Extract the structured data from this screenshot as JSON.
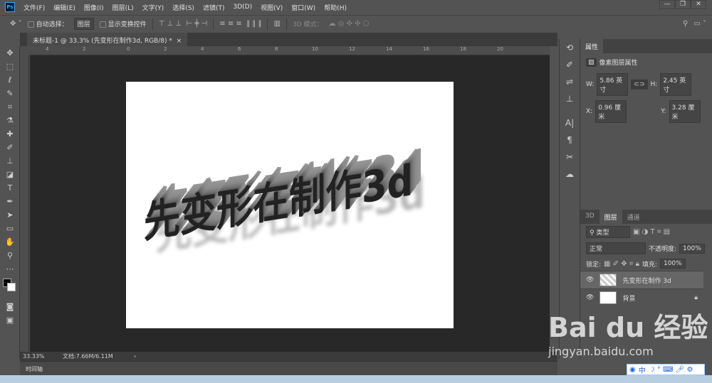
{
  "app": {
    "logo": "Ps"
  },
  "menu": [
    "文件(F)",
    "编辑(E)",
    "图像(I)",
    "图层(L)",
    "文字(Y)",
    "选择(S)",
    "滤镜(T)",
    "3D(D)",
    "视图(V)",
    "窗口(W)",
    "帮助(H)"
  ],
  "window_controls": {
    "minimize": "—",
    "restore": "❐",
    "close": "✕"
  },
  "options": {
    "auto_select_label": "自动选择：",
    "auto_select_value": "图层",
    "show_transform_label": "显示变换控件",
    "mode3d_label": "3D 模式："
  },
  "document_tab": {
    "title": "未标题-1 @ 33.3% (先变形在制作3d, RGB/8) *",
    "close": "×"
  },
  "ruler_ticks": [
    "4",
    "2",
    "0",
    "2",
    "4",
    "6",
    "8",
    "10",
    "12",
    "14",
    "16",
    "18",
    "20"
  ],
  "canvas": {
    "text": "先变形在制作3d"
  },
  "status": {
    "zoom": "33.33%",
    "doc": "文档:7.66M/6.11M",
    "arrow": "›"
  },
  "timeline": {
    "label": "时间轴"
  },
  "properties": {
    "tab": "属性",
    "title": "像素图层属性",
    "w_label": "W:",
    "w": "5.86 英寸",
    "h_label": "H:",
    "h": "2.45 英寸",
    "x_label": "X:",
    "x": "0.96 厘米",
    "y_label": "Y:",
    "y": "3.28 厘米"
  },
  "layers": {
    "tabs": [
      "3D",
      "图层",
      "通道"
    ],
    "filter": "类型",
    "blend": "正常",
    "opacity_label": "不透明度:",
    "opacity": "100%",
    "lock_label": "锁定:",
    "fill_label": "填充:",
    "fill": "100%",
    "items": [
      {
        "name": "先变形在制作 3d"
      },
      {
        "name": "背景"
      }
    ]
  },
  "watermark": {
    "brand": "Bai du 经验",
    "url": "jingyan.baidu.com"
  },
  "ime": {
    "mode": "中"
  }
}
